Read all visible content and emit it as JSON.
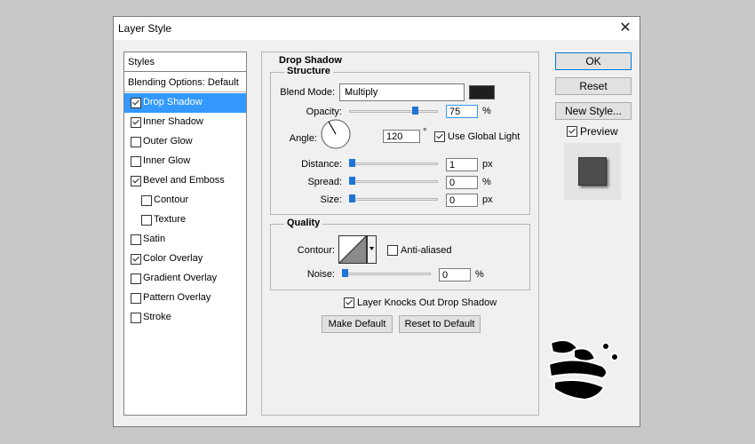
{
  "window": {
    "title": "Layer Style",
    "close": "✕"
  },
  "styles_panel": {
    "header": "Styles",
    "blending_options": "Blending Options: Default",
    "items": [
      {
        "label": "Drop Shadow",
        "checked": true,
        "selected": true,
        "indent": 0
      },
      {
        "label": "Inner Shadow",
        "checked": true,
        "selected": false,
        "indent": 0
      },
      {
        "label": "Outer Glow",
        "checked": false,
        "selected": false,
        "indent": 0
      },
      {
        "label": "Inner Glow",
        "checked": false,
        "selected": false,
        "indent": 0
      },
      {
        "label": "Bevel and Emboss",
        "checked": true,
        "selected": false,
        "indent": 0
      },
      {
        "label": "Contour",
        "checked": false,
        "selected": false,
        "indent": 1
      },
      {
        "label": "Texture",
        "checked": false,
        "selected": false,
        "indent": 1
      },
      {
        "label": "Satin",
        "checked": false,
        "selected": false,
        "indent": 0
      },
      {
        "label": "Color Overlay",
        "checked": true,
        "selected": false,
        "indent": 0
      },
      {
        "label": "Gradient Overlay",
        "checked": false,
        "selected": false,
        "indent": 0
      },
      {
        "label": "Pattern Overlay",
        "checked": false,
        "selected": false,
        "indent": 0
      },
      {
        "label": "Stroke",
        "checked": false,
        "selected": false,
        "indent": 0
      }
    ]
  },
  "drop_shadow": {
    "title": "Drop Shadow",
    "structure": {
      "title": "Structure",
      "blend_mode_label": "Blend Mode:",
      "blend_mode_value": "Multiply",
      "shadow_color": "#1f1f1f",
      "opacity_label": "Opacity:",
      "opacity_value": "75",
      "opacity_unit": "%",
      "opacity_fraction": 0.75,
      "angle_label": "Angle:",
      "angle_value": "120",
      "angle_unit": "°",
      "use_global_light": "Use Global Light",
      "use_global_light_checked": true,
      "distance_label": "Distance:",
      "distance_value": "1",
      "distance_unit": "px",
      "spread_label": "Spread:",
      "spread_value": "0",
      "spread_unit": "%",
      "size_label": "Size:",
      "size_value": "0",
      "size_unit": "px"
    },
    "quality": {
      "title": "Quality",
      "contour_label": "Contour:",
      "anti_aliased": "Anti-aliased",
      "anti_aliased_checked": false,
      "noise_label": "Noise:",
      "noise_value": "0",
      "noise_unit": "%"
    },
    "knocks_out": "Layer Knocks Out Drop Shadow",
    "knocks_out_checked": true,
    "make_default": "Make Default",
    "reset_to_default": "Reset to Default"
  },
  "buttons": {
    "ok": "OK",
    "reset": "Reset",
    "new_style": "New Style...",
    "preview": "Preview",
    "preview_checked": true
  },
  "colors": {
    "selection": "#3399ff",
    "slider_thumb": "#1e75d5",
    "preview_fill": "#4d4d4d"
  }
}
